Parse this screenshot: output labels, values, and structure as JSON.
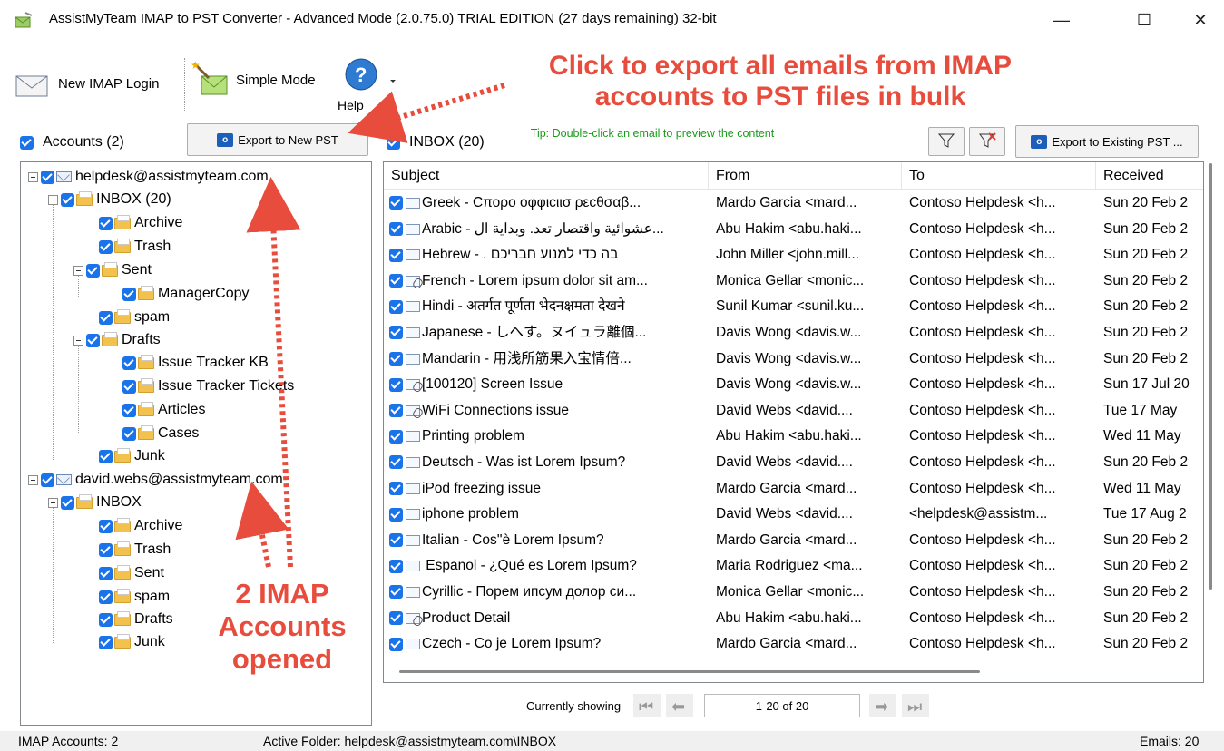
{
  "window": {
    "title": "AssistMyTeam IMAP to PST Converter - Advanced Mode (2.0.75.0) TRIAL EDITION (27 days remaining) 32-bit",
    "minimize": "—",
    "maximize": "☐",
    "close": "✕"
  },
  "toolbar": {
    "new_imap_login": "New IMAP Login",
    "simple_mode": "Simple Mode",
    "help": "Help"
  },
  "accounts_header": {
    "label": "Accounts (2)"
  },
  "export_new_pst": "Export to New PST",
  "inbox_header": {
    "label": "INBOX (20)"
  },
  "tip": "Tip: Double-click an email to preview the content",
  "export_existing_pst": "Export to Existing PST ...",
  "tree": {
    "account1": "helpdesk@assistmyteam.com",
    "a1_inbox": "INBOX (20)",
    "a1_archive": "Archive",
    "a1_trash": "Trash",
    "a1_sent": "Sent",
    "a1_managercopy": "ManagerCopy",
    "a1_spam": "spam",
    "a1_drafts": "Drafts",
    "a1_issue_kb": "Issue Tracker KB",
    "a1_issue_tickets": "Issue Tracker Tickets",
    "a1_articles": "Articles",
    "a1_cases": "Cases",
    "a1_junk": "Junk",
    "account2": "david.webs@assistmyteam.com",
    "a2_inbox": "INBOX",
    "a2_archive": "Archive",
    "a2_trash": "Trash",
    "a2_sent": "Sent",
    "a2_spam": "spam",
    "a2_drafts": "Drafts",
    "a2_junk": "Junk"
  },
  "columns": {
    "subject": "Subject",
    "from": "From",
    "to": "To",
    "received": "Received"
  },
  "emails": [
    {
      "subject": "Greek - Cπορο οφφιcιισ ρεcθσαβ...",
      "from": "Mardo Garcia <mard...",
      "to": "Contoso Helpdesk <h...",
      "received": "Sun 20 Feb 2",
      "att": false
    },
    {
      "subject": "Arabic - عشوائية واقتصار تعد. وبداية ال...",
      "from": "Abu Hakim <abu.haki...",
      "to": "Contoso Helpdesk <h...",
      "received": "Sun 20 Feb 2",
      "att": false
    },
    {
      "subject": "Hebrew - . בה כדי למנוע חבריכם",
      "from": "John Miller <john.mill...",
      "to": "Contoso Helpdesk <h...",
      "received": "Sun 20 Feb 2",
      "att": false
    },
    {
      "subject": "French - Lorem ipsum dolor sit am...",
      "from": "Monica Gellar <monic...",
      "to": "Contoso Helpdesk <h...",
      "received": "Sun 20 Feb 2",
      "att": true
    },
    {
      "subject": "Hindi - अतर्गत पूर्णता भेदनक्षमता देखने",
      "from": "Sunil Kumar <sunil.ku...",
      "to": "Contoso Helpdesk <h...",
      "received": "Sun 20 Feb 2",
      "att": false
    },
    {
      "subject": "Japanese - しへす。ヌイュラ離個...",
      "from": "Davis Wong <davis.w...",
      "to": "Contoso Helpdesk <h...",
      "received": "Sun 20 Feb 2",
      "att": false
    },
    {
      "subject": "Mandarin - 用浅所筋果入宝情倍...",
      "from": "Davis Wong <davis.w...",
      "to": "Contoso Helpdesk <h...",
      "received": "Sun 20 Feb 2",
      "att": false
    },
    {
      "subject": "[100120] Screen Issue",
      "from": "Davis Wong <davis.w...",
      "to": "Contoso Helpdesk <h...",
      "received": "Sun 17 Jul 20",
      "att": true
    },
    {
      "subject": "WiFi Connections issue",
      "from": "David Webs <david....",
      "to": "Contoso Helpdesk <h...",
      "received": "Tue 17 May",
      "att": true
    },
    {
      "subject": "Printing problem",
      "from": "Abu Hakim <abu.haki...",
      "to": "Contoso Helpdesk <h...",
      "received": "Wed 11 May",
      "att": false
    },
    {
      "subject": "Deutsch - Was ist Lorem Ipsum?",
      "from": "David Webs <david....",
      "to": "Contoso Helpdesk <h...",
      "received": "Sun 20 Feb 2",
      "att": false
    },
    {
      "subject": "iPod freezing issue",
      "from": "Mardo Garcia <mard...",
      "to": "Contoso Helpdesk <h...",
      "received": "Wed 11 May",
      "att": false
    },
    {
      "subject": "iphone problem",
      "from": "David Webs <david....",
      "to": "<helpdesk@assistm...",
      "received": "Tue 17 Aug 2",
      "att": false
    },
    {
      "subject": "Italian - Cos''è Lorem Ipsum?",
      "from": "Mardo Garcia <mard...",
      "to": "Contoso Helpdesk <h...",
      "received": "Sun 20 Feb 2",
      "att": false
    },
    {
      "subject": " Espanol - ¿Qué es Lorem Ipsum?",
      "from": "Maria Rodriguez <ma...",
      "to": "Contoso Helpdesk <h...",
      "received": "Sun 20 Feb 2",
      "att": false
    },
    {
      "subject": "Cyrillic - Порем ипсум долор си...",
      "from": "Monica Gellar <monic...",
      "to": "Contoso Helpdesk <h...",
      "received": "Sun 20 Feb 2",
      "att": false
    },
    {
      "subject": "Product Detail",
      "from": "Abu Hakim <abu.haki...",
      "to": "Contoso Helpdesk <h...",
      "received": "Sun 20 Feb 2",
      "att": true
    },
    {
      "subject": "Czech - Co je Lorem Ipsum?",
      "from": "Mardo Garcia <mard...",
      "to": "Contoso Helpdesk <h...",
      "received": "Sun 20 Feb 2",
      "att": false
    }
  ],
  "pager": {
    "label": "Currently showing",
    "range": "1-20 of 20"
  },
  "status": {
    "accounts": "IMAP Accounts: 2",
    "active_folder": "Active Folder: helpdesk@assistmyteam.com\\INBOX",
    "emails": "Emails: 20"
  },
  "annotations": {
    "export_line1": "Click to export all emails from IMAP",
    "export_line2": "accounts to PST files in bulk",
    "accounts_line1": "2 IMAP",
    "accounts_line2": "Accounts",
    "accounts_line3": "opened"
  },
  "colors": {
    "checkbox": "#1a73e8",
    "annotation": "#e74c3c",
    "tip": "#1a9a1a"
  }
}
